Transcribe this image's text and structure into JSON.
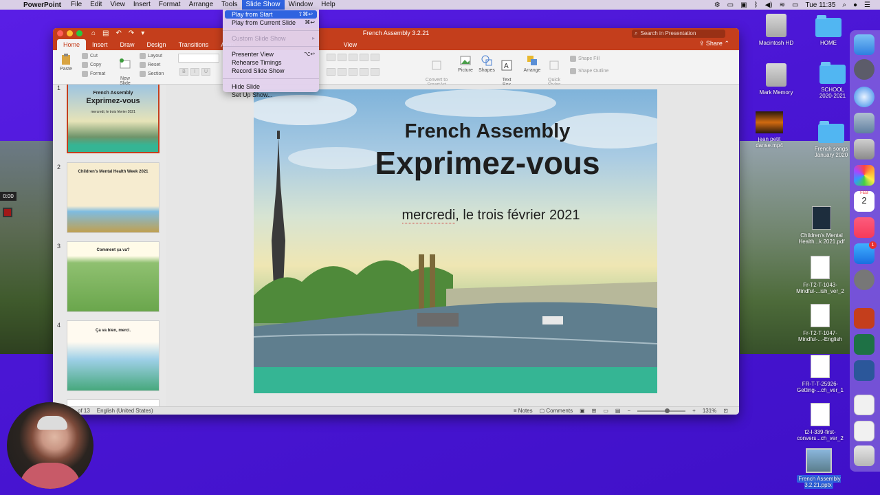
{
  "menubar": {
    "app_name": "PowerPoint",
    "items": [
      "File",
      "Edit",
      "View",
      "Insert",
      "Format",
      "Arrange",
      "Tools",
      "Slide Show",
      "Window",
      "Help"
    ],
    "active": "Slide Show",
    "clock": "Tue 11:35"
  },
  "slideshow_menu": {
    "items": [
      {
        "label": "Play from Start",
        "shortcut": "⇧⌘↩",
        "state": "highlighted"
      },
      {
        "label": "Play from Current Slide",
        "shortcut": "⌘↩",
        "state": "normal"
      },
      {
        "label": "Custom Slide Show",
        "shortcut": "▸",
        "state": "disabled"
      },
      {
        "label": "Presenter View",
        "shortcut": "⌥↩",
        "state": "normal"
      },
      {
        "label": "Rehearse Timings",
        "shortcut": "",
        "state": "normal"
      },
      {
        "label": "Record Slide Show",
        "shortcut": "",
        "state": "normal"
      },
      {
        "label": "Hide Slide",
        "shortcut": "",
        "state": "normal"
      },
      {
        "label": "Set Up Show...",
        "shortcut": "",
        "state": "normal"
      }
    ]
  },
  "window": {
    "title": "French Assembly 3.2.21",
    "search_placeholder": "Search in Presentation",
    "share_label": "Share",
    "tabs": [
      "Home",
      "Insert",
      "Draw",
      "Design",
      "Transitions",
      "Anim",
      "View"
    ],
    "active_tab": "Home"
  },
  "ribbon": {
    "paste": "Paste",
    "cut": "Cut",
    "copy": "Copy",
    "format": "Format",
    "new_slide": "New\nSlide",
    "layout": "Layout",
    "reset": "Reset",
    "section": "Section",
    "convert_smartart": "Convert to\nSmartArt",
    "picture": "Picture",
    "shapes": "Shapes",
    "text_box": "Text\nBox",
    "arrange": "Arrange",
    "quick_styles": "Quick\nStyles",
    "shape_fill": "Shape Fill",
    "shape_outline": "Shape Outline"
  },
  "thumbnails": [
    {
      "num": "1",
      "title": "French Assembly",
      "heading": "Exprimez-vous",
      "sub": "mercredi, le trois février 2021"
    },
    {
      "num": "2",
      "title": "Children's Mental Health Week 2021"
    },
    {
      "num": "3",
      "title": "Comment ça va?"
    },
    {
      "num": "4",
      "title": "Ça va bien, merci."
    }
  ],
  "slide": {
    "title": "French Assembly",
    "heading": "Exprimez-vous",
    "date_word": "mercredi",
    "date_rest": ", le trois février 2021"
  },
  "statusbar": {
    "slide_count": "of 13",
    "language": "English (United States)",
    "notes": "Notes",
    "comments": "Comments",
    "zoom": "131%"
  },
  "desktop_icons": [
    {
      "label": "Macintosh HD",
      "type": "drive"
    },
    {
      "label": "HOME",
      "type": "folder"
    },
    {
      "label": "Mark Memory",
      "type": "drive"
    },
    {
      "label": "SCHOOL\n2020-2021",
      "type": "folder"
    },
    {
      "label": "jean petit\ndanse.mp4",
      "type": "video"
    },
    {
      "label": "French songs\nJanuary 2020",
      "type": "folder"
    },
    {
      "label": "Children's Mental\nHealth...k 2021.pdf",
      "type": "doc"
    },
    {
      "label": "Fr-T2-T-1043-\nMindful-...ish_ver_2",
      "type": "doc"
    },
    {
      "label": "Fr-T2-T-1047-\nMindful-...-English",
      "type": "doc"
    },
    {
      "label": "FR-T-T-25926-\nGetting-...ch_ver_1",
      "type": "doc"
    },
    {
      "label": "t2-l-339-first-\nconvers...ch_ver_2",
      "type": "doc"
    },
    {
      "label": "French Assembly\n3.2.21.pptx",
      "type": "pptx"
    }
  ],
  "dock": {
    "calendar_month": "FEB",
    "calendar_day": "2",
    "badge_count": "1"
  },
  "recording": {
    "time": "0:00"
  },
  "colors": {
    "ppt_red": "#c43e1c",
    "menu_highlight": "#2f63e0",
    "slide_teal": "#35b594"
  }
}
